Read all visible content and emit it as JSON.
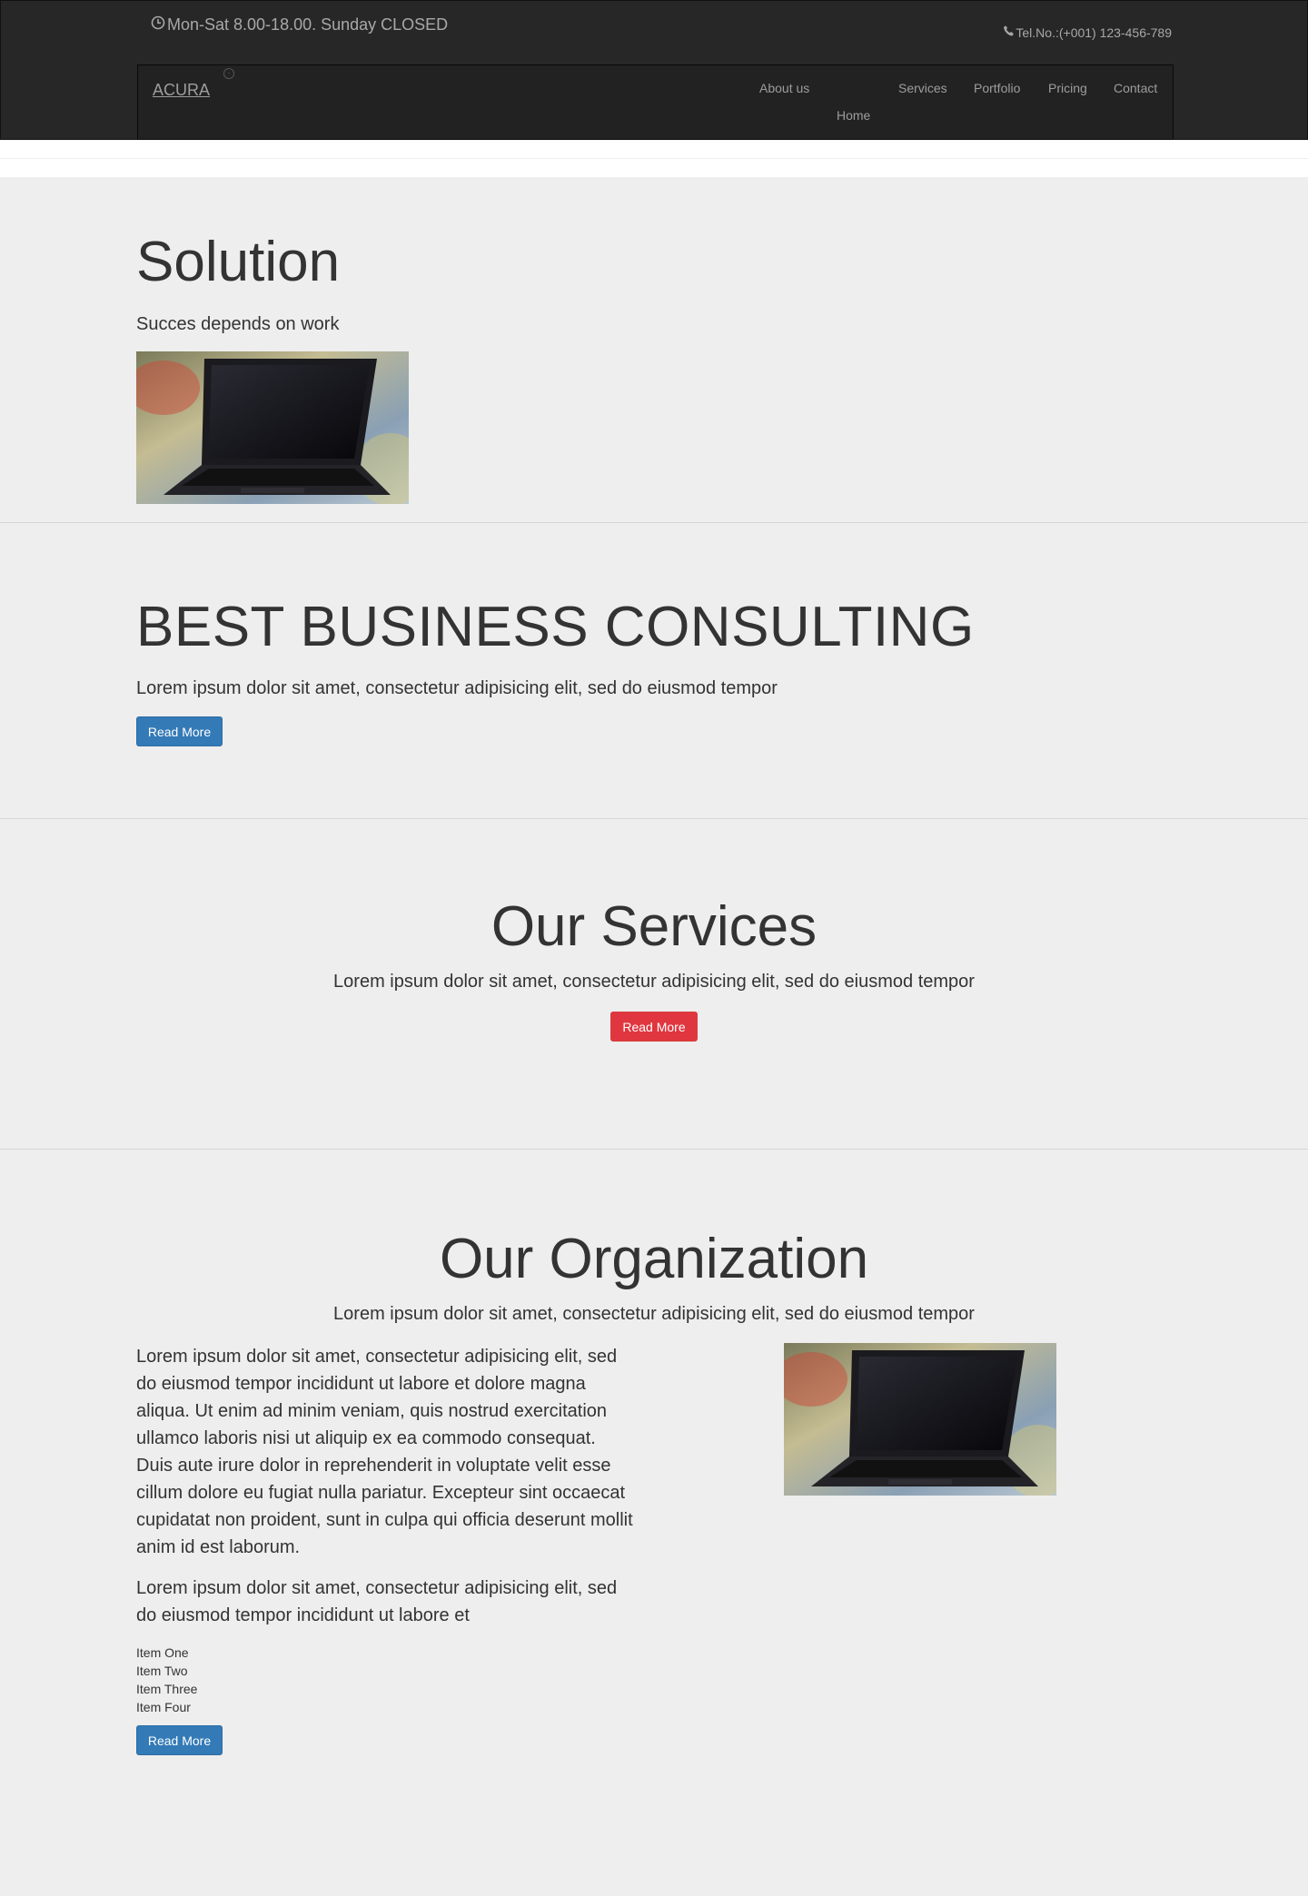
{
  "topbar": {
    "hours": "Mon-Sat 8.00-18.00. Sunday CLOSED",
    "phone": "Tel.No.:(+001) 123-456-789"
  },
  "navbar": {
    "brand": "ACURA",
    "items": [
      "About us",
      "Home",
      "Services",
      "Portfolio",
      "Pricing",
      "Contact"
    ]
  },
  "solution": {
    "title": "Solution",
    "subtitle": "Succes depends on work"
  },
  "hero": {
    "title": "BEST BUSINESS CONSULTING",
    "lead": "Lorem ipsum dolor sit amet, consectetur adipisicing elit, sed do eiusmod tempor",
    "button": "Read More"
  },
  "services": {
    "title": "Our Services",
    "lead": "Lorem ipsum dolor sit amet, consectetur adipisicing elit, sed do eiusmod tempor",
    "button": "Read More"
  },
  "organization": {
    "title": "Our Organization",
    "lead": "Lorem ipsum dolor sit amet, consectetur adipisicing elit, sed do eiusmod tempor",
    "paragraph1": "Lorem ipsum dolor sit amet, consectetur adipisicing elit, sed do eiusmod tempor incididunt ut labore et dolore magna aliqua. Ut enim ad minim veniam, quis nostrud exercitation ullamco laboris nisi ut aliquip ex ea commodo consequat. Duis aute irure dolor in reprehenderit in voluptate velit esse cillum dolore eu fugiat nulla pariatur. Excepteur sint occaecat cupidatat non proident, sunt in culpa qui officia deserunt mollit anim id est laborum.",
    "paragraph2": "Lorem ipsum dolor sit amet, consectetur adipisicing elit, sed do eiusmod tempor incididunt ut labore et",
    "items": [
      "Item One",
      "Item Two",
      "Item Three",
      "Item Four"
    ],
    "button": "Read More"
  },
  "icons": {
    "hours": "clock-icon",
    "phone": "phone-icon"
  },
  "colors": {
    "topbar": "#272727",
    "page": "#eeeeee",
    "primary": "#337ab7",
    "danger": "#e0363f"
  }
}
